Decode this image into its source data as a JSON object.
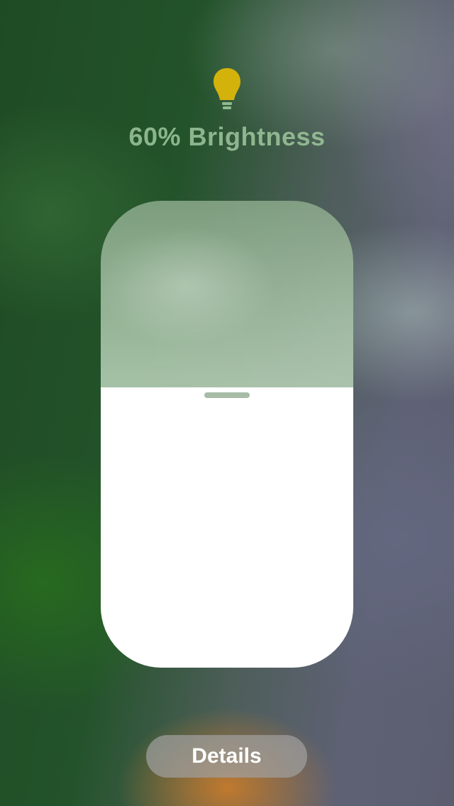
{
  "light": {
    "icon": "lightbulb-icon",
    "icon_color": "#d4b20c",
    "title": "60% Brightness",
    "brightness_percent": 60
  },
  "details_button": {
    "label": "Details"
  }
}
